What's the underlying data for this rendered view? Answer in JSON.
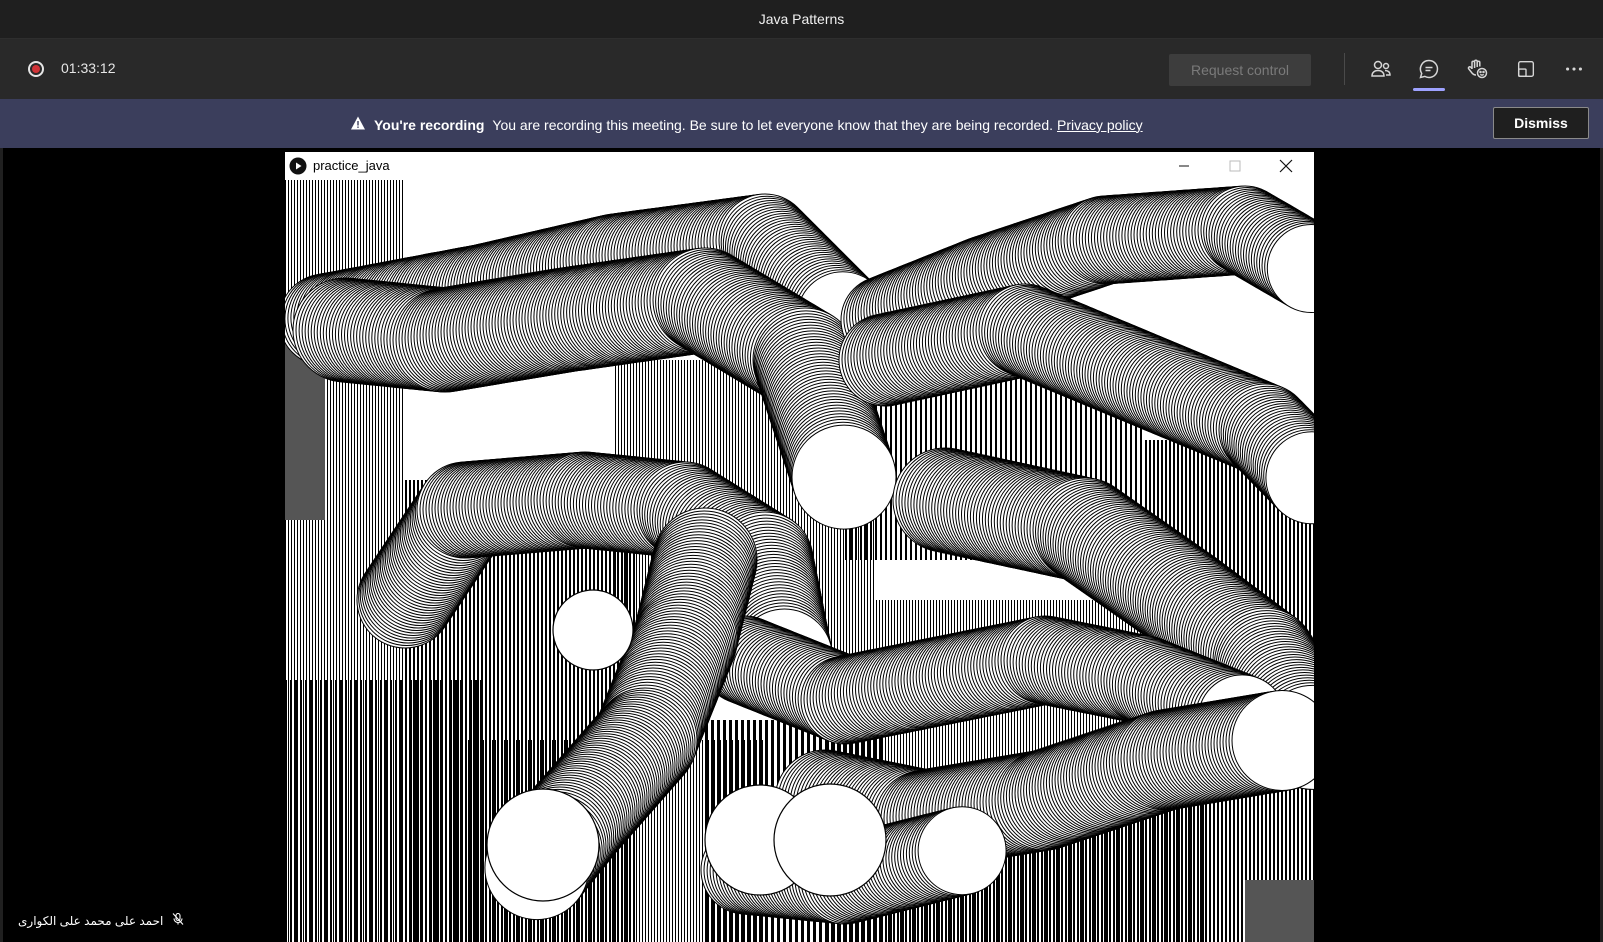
{
  "window": {
    "title": "Java Patterns"
  },
  "toolbar": {
    "timer": "01:33:12",
    "request_control_label": "Request control"
  },
  "banner": {
    "title": "You're recording",
    "message": "You are recording this meeting. Be sure to let everyone know that they are being recorded.",
    "link": "Privacy policy",
    "dismiss_label": "Dismiss"
  },
  "shared_window": {
    "title": "practice_java"
  },
  "participant": {
    "name": "احمد على محمد على الكوارى"
  },
  "colors": {
    "banner_bg": "#3b3e5c",
    "record_red": "#d13438",
    "chat_accent": "#9ea2ff"
  },
  "icons": [
    "record-icon",
    "people-icon",
    "chat-icon",
    "reactions-icon",
    "share-tray-icon",
    "more-icon",
    "warning-icon",
    "app-play-icon",
    "minimize-icon",
    "maximize-icon",
    "close-icon",
    "mic-off-icon"
  ]
}
